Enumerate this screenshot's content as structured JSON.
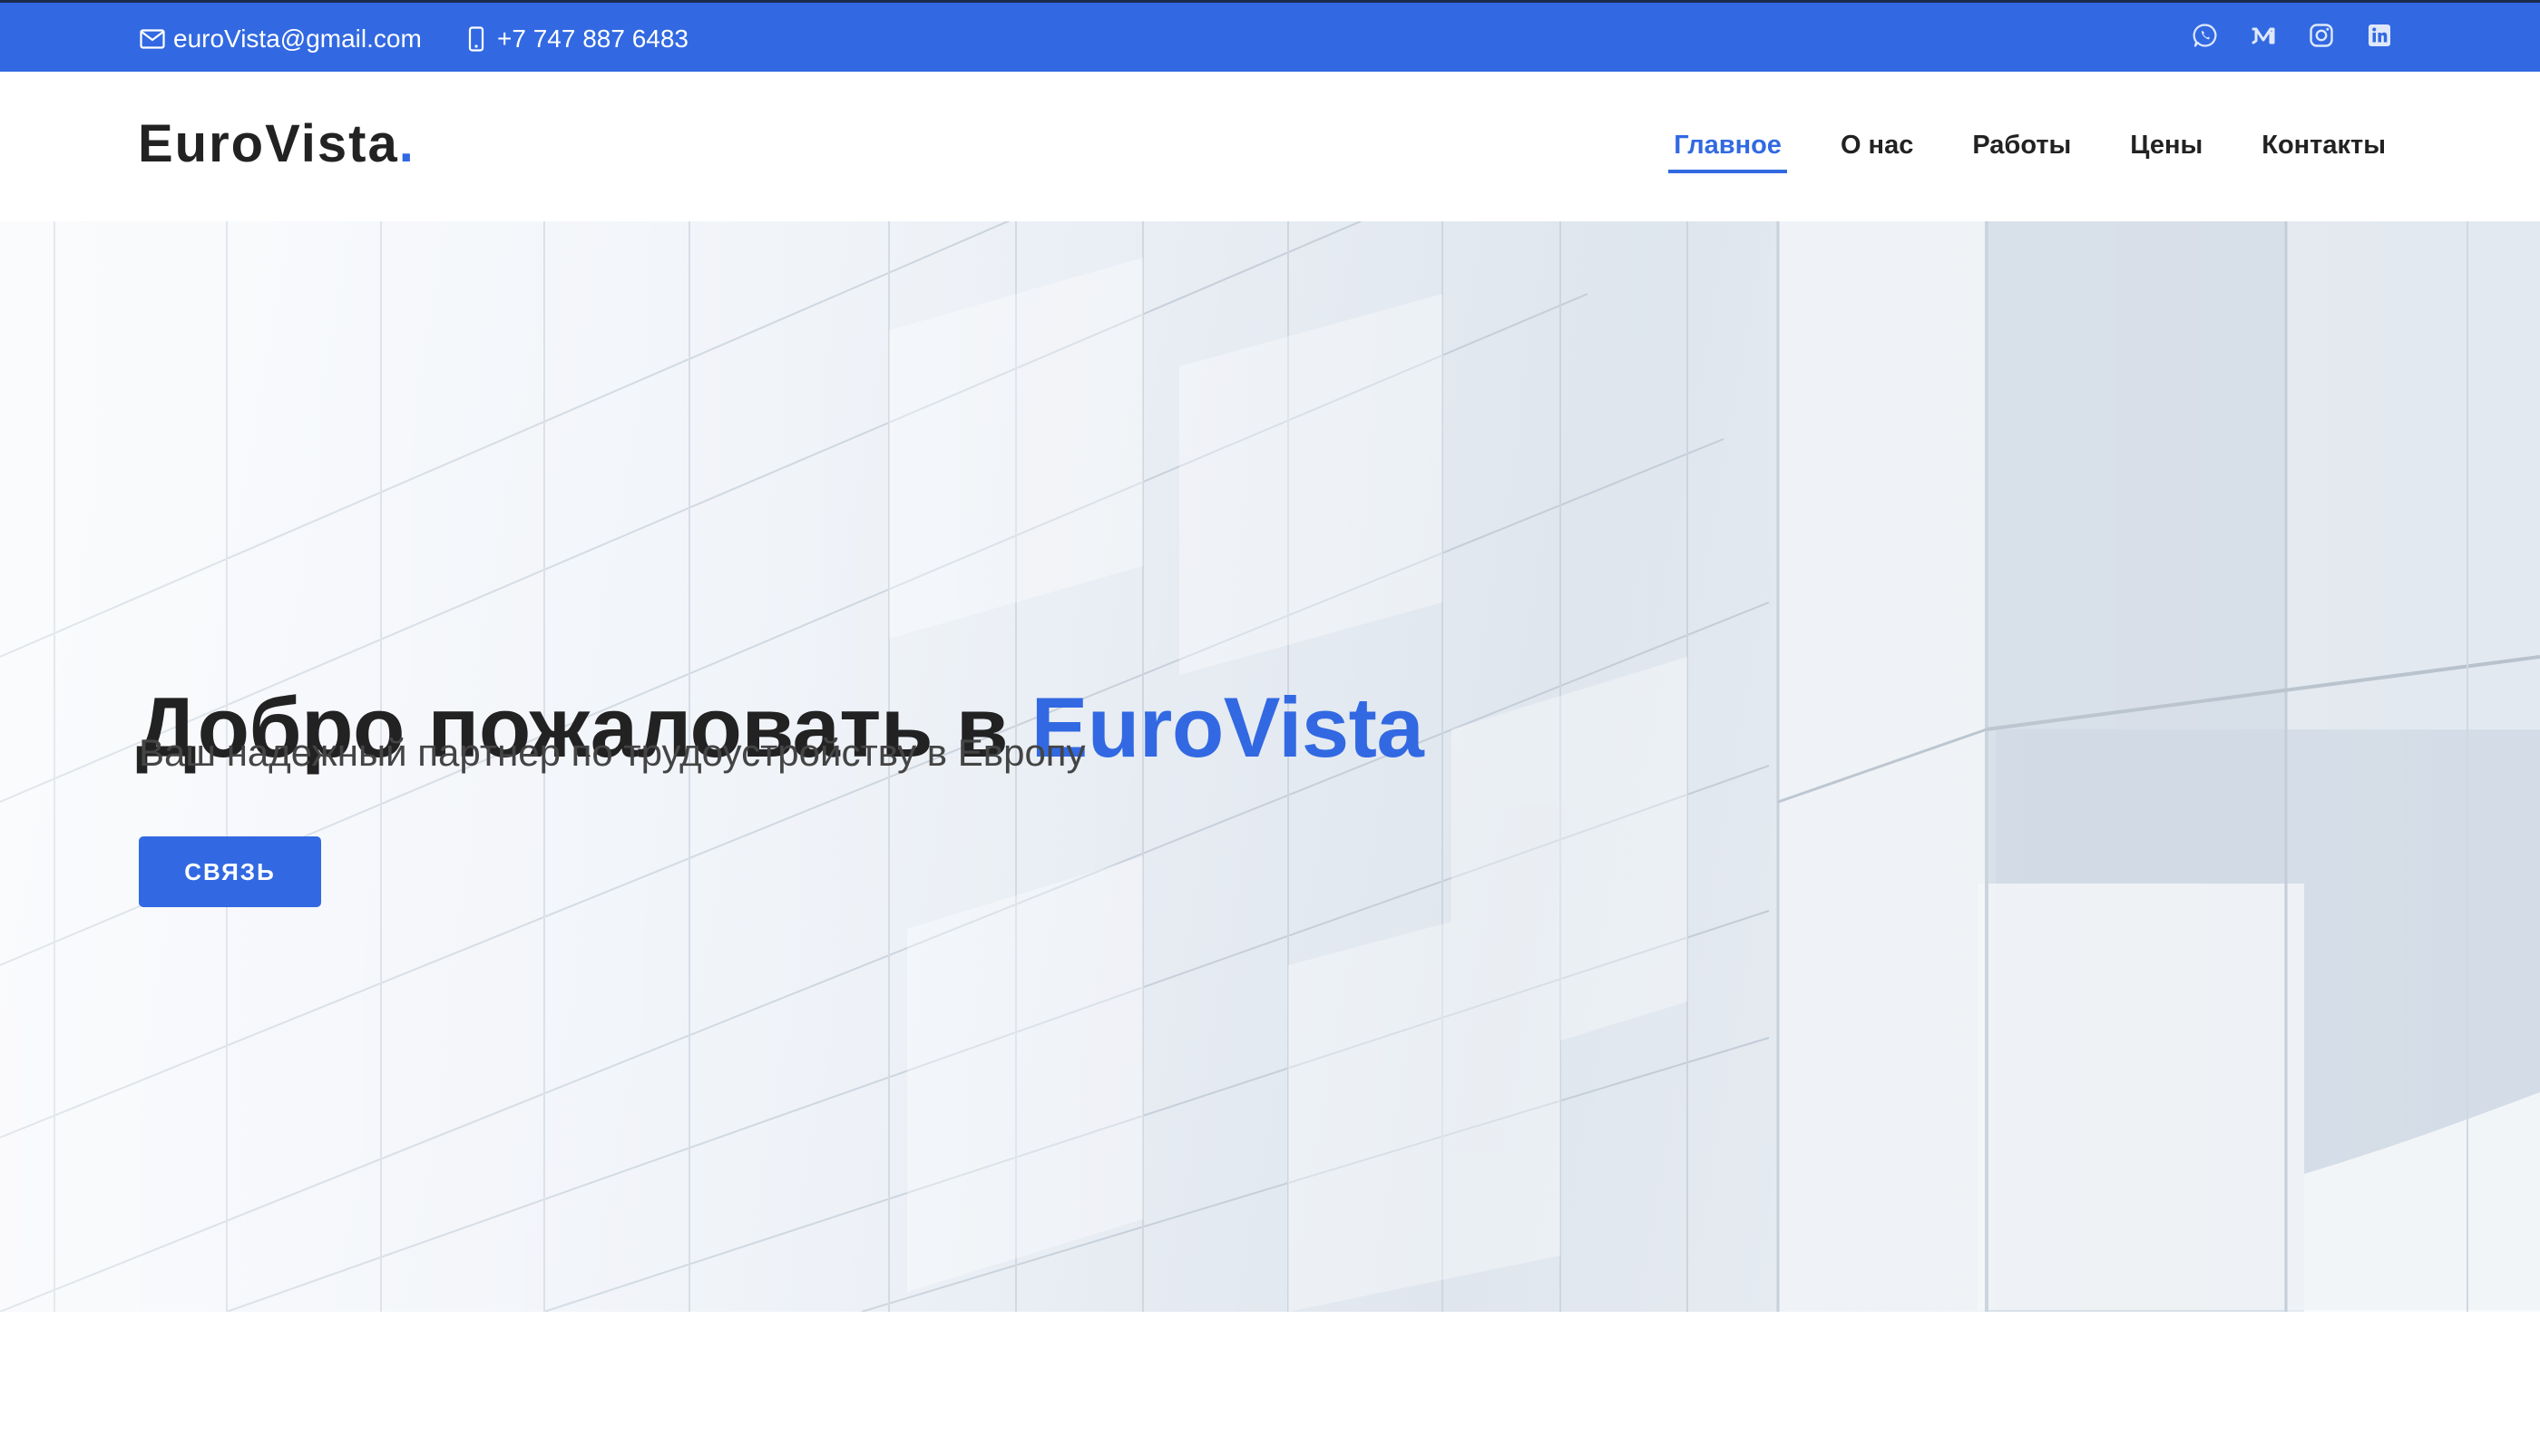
{
  "colors": {
    "accent": "#3269e2",
    "topbar_border": "#1c2a4d",
    "text_dark": "#222222",
    "text_muted": "#444444"
  },
  "topbar": {
    "email": {
      "icon": "envelope-icon",
      "text": "euroVista@gmail.com"
    },
    "phone": {
      "icon": "phone-icon",
      "text": "+7 747 887 6483"
    },
    "socials": [
      {
        "icon": "whatsapp-icon"
      },
      {
        "icon": "medium-icon"
      },
      {
        "icon": "instagram-icon"
      },
      {
        "icon": "linkedin-icon"
      }
    ]
  },
  "header": {
    "logo_text": "EuroVista",
    "logo_dot": ".",
    "nav": [
      {
        "label": "Главное",
        "active": true
      },
      {
        "label": "О нас",
        "active": false
      },
      {
        "label": "Работы",
        "active": false
      },
      {
        "label": "Цены",
        "active": false
      },
      {
        "label": "Контакты",
        "active": false
      }
    ]
  },
  "hero": {
    "title_prefix": "Добро пожаловать в ",
    "title_brand": "EuroVista",
    "subtitle": "Ваш надежный партнер по трудоустройству в Европу",
    "cta_label": "СВЯЗЬ"
  }
}
